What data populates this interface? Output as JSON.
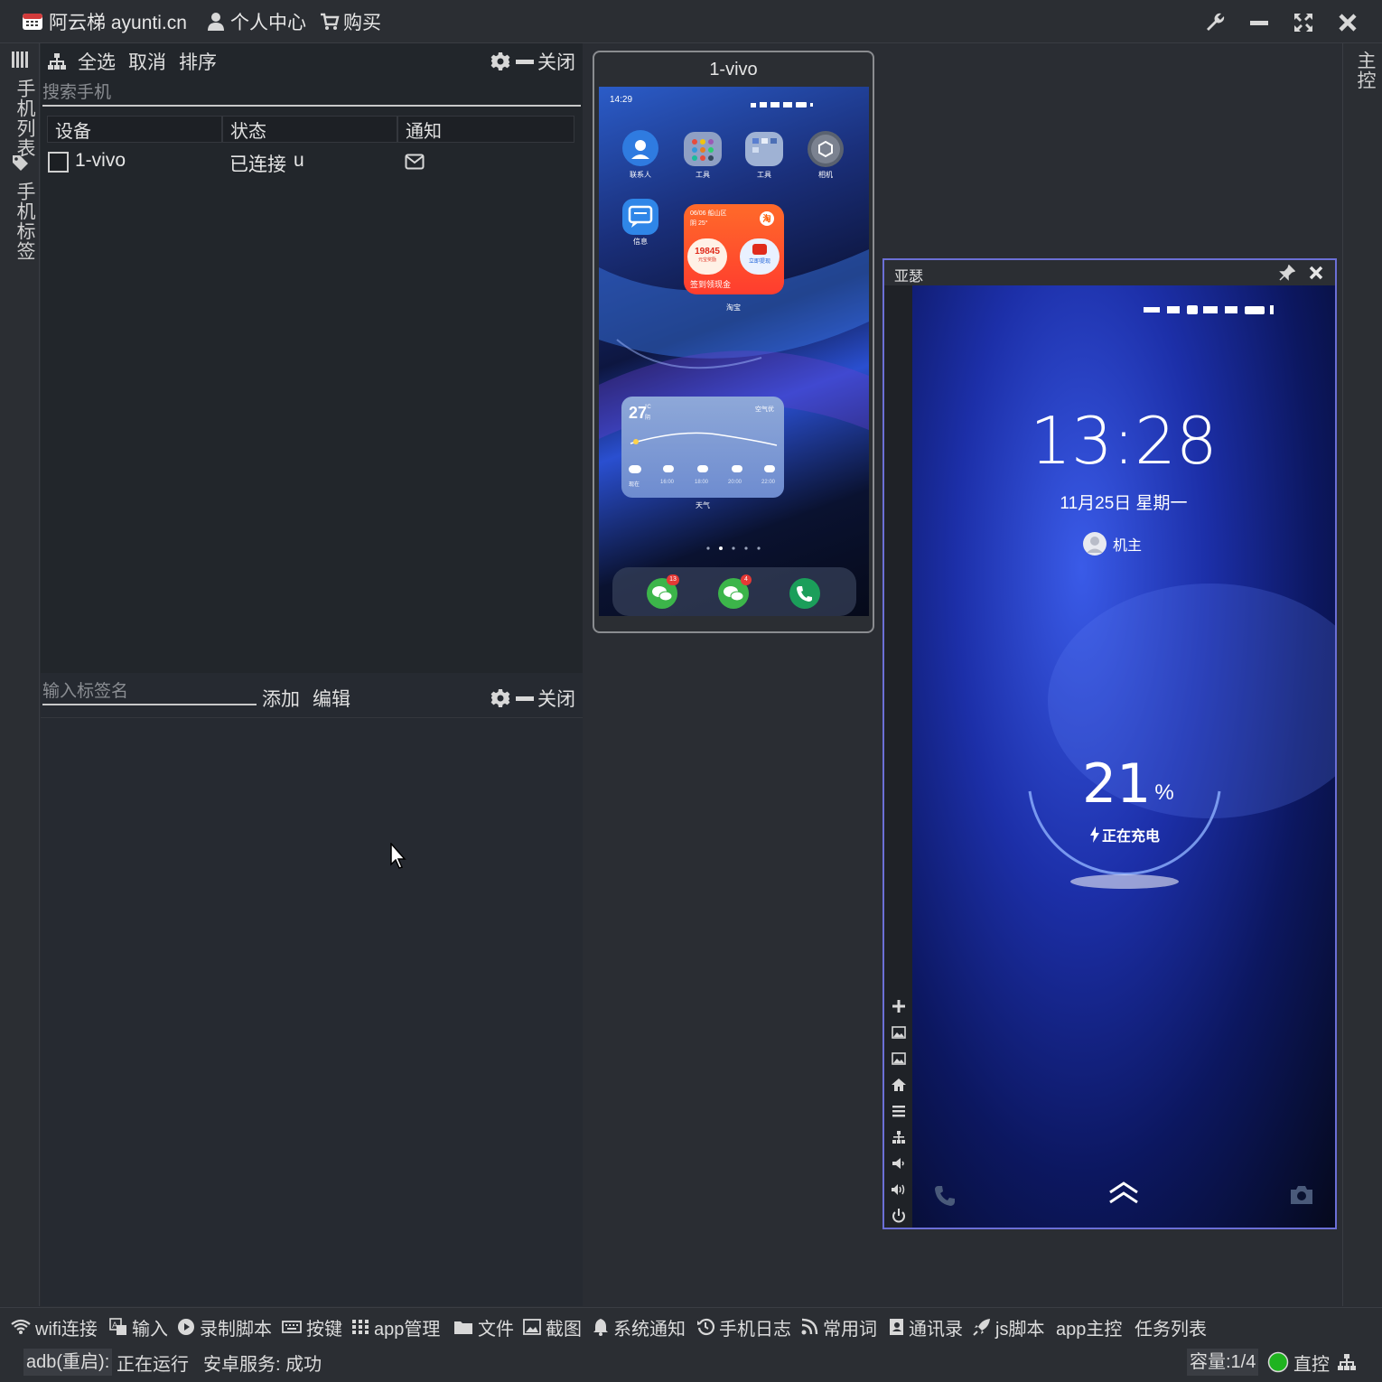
{
  "titlebar": {
    "app_title": "阿云梯 ayunti.cn",
    "user_center": "个人中心",
    "buy": "购买"
  },
  "leftstrip": {
    "phone_list": "手机列表",
    "phone_tags": "手机标签"
  },
  "rightstrip": {
    "label": "主控"
  },
  "device_panel": {
    "select_all": "全选",
    "cancel": "取消",
    "sort": "排序",
    "close": "关闭",
    "search_placeholder": "搜索手机",
    "columns": [
      "设备",
      "状态",
      "通知"
    ],
    "rows": [
      {
        "device": "1-vivo",
        "status": "已连接",
        "status_flag": "u"
      }
    ]
  },
  "tag_panel": {
    "tag_placeholder": "输入标签名",
    "add": "添加",
    "edit": "编辑",
    "close": "关闭"
  },
  "phone1": {
    "title": "1-vivo",
    "status_time": "14:29",
    "apps": [
      {
        "name": "联系人",
        "color": "#2f7be0"
      },
      {
        "name": "工具",
        "color": "#7d8fb8"
      },
      {
        "name": "工具",
        "color": "#8fa3c6"
      },
      {
        "name": "相机",
        "color": "#5a6270"
      },
      {
        "name": "信息",
        "color": "#2f86e8"
      }
    ],
    "taobao_widget": {
      "header": "06/06 船山区",
      "weather": "阴 25°",
      "amount": "19845",
      "amount_sub": "元宝奖励",
      "withdraw": "立即提现",
      "footer": "签到领现金",
      "label": "淘宝"
    },
    "weather_widget": {
      "temp": "27",
      "unit": "°C",
      "cond": "阴",
      "aqi": "空气优",
      "times": [
        "现在",
        "16:00",
        "18:00",
        "20:00",
        "22:00"
      ],
      "label": "天气"
    },
    "dock_badges": [
      "13",
      "4"
    ]
  },
  "phone2": {
    "title": "亚瑟",
    "time": "13:28",
    "date": "11月25日 星期一",
    "owner": "机主",
    "battery": "21",
    "battery_unit": "%",
    "charging": "正在充电"
  },
  "footer": {
    "items": [
      "wifi连接",
      "输入",
      "录制脚本",
      "按键",
      "app管理",
      "文件",
      "截图",
      "系统通知",
      "手机日志",
      "常用词",
      "通讯录",
      "js脚本",
      "app主控",
      "任务列表"
    ],
    "adb_label": "adb(重启):",
    "adb_status": "正在运行",
    "service": "安卓服务: 成功",
    "capacity": "容量:1/4",
    "direct": "直控"
  },
  "colors": {
    "accent_purple": "#6b6fd6",
    "status_green": "#1fb31f"
  }
}
